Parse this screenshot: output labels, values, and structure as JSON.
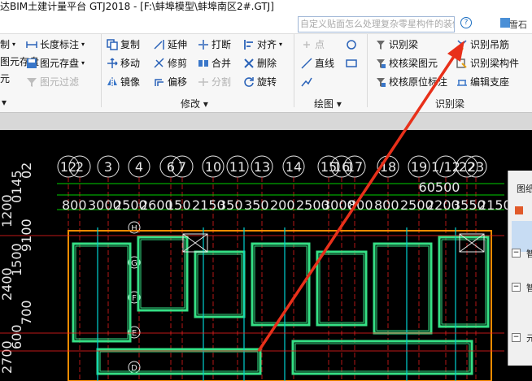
{
  "window": {
    "title": "达BIM土建计量平台 GTJ2018 - [F:\\蚌埠模型\\蚌埠南区2#.GTJ]"
  },
  "search": {
    "placeholder": "自定义贴面怎么处理复杂零星构件的装修?"
  },
  "user": {
    "name": "雪石"
  },
  "ribbon": {
    "col1": [
      "制",
      "图元存盘",
      "元"
    ],
    "col2": [
      "长度标注",
      "图元存盘",
      "图元过滤"
    ],
    "modify": {
      "copy": "复制",
      "extend": "延伸",
      "break": "打断",
      "align": "对齐",
      "move": "移动",
      "trim": "修剪",
      "merge": "合并",
      "delete": "删除",
      "mirror": "镜像",
      "offset": "偏移",
      "split": "分割",
      "rotate": "旋转",
      "group_label": "修改"
    },
    "draw": {
      "point": "点",
      "line": "直线",
      "group_label": "绘图"
    },
    "beam": {
      "identify_beam": "识别梁",
      "identify_hanger": "识别吊筋",
      "check_beam": "校核梁图元",
      "identify_beam_comp": "识别梁构件",
      "check_origin": "校核原位标注",
      "edit_support": "编辑支座",
      "group_label": "识别梁"
    },
    "col1_label": "制"
  },
  "cad": {
    "axis_top": [
      "12",
      "2",
      "3",
      "4",
      "6",
      "7",
      "10",
      "11",
      "13",
      "14",
      "15",
      "16",
      "17",
      "18",
      "19",
      "1/12",
      "22",
      "23"
    ],
    "axis_nums_row": [
      "800",
      "3000",
      "2500",
      "2600",
      "150",
      "2150",
      "350",
      "350",
      "200",
      "2500",
      "3000",
      "800",
      "800",
      "2500",
      "2200",
      "3550",
      "2150"
    ],
    "top_dim": "60500",
    "left_dims": [
      "2700",
      "600",
      "700",
      "2400",
      "1500",
      "9100",
      "1200",
      "0145",
      "02"
    ],
    "left_letters": [
      "H",
      "G",
      "F",
      "E",
      "D"
    ]
  },
  "panel": {
    "title": "图纸",
    "rows": [
      "一",
      "智",
      "智",
      "元"
    ]
  },
  "colors": {
    "arrow": "#e8301a",
    "grid_green": "#00d000",
    "wall_green": "#35e085",
    "cyan": "#00d0d0",
    "red_line": "#ff2020",
    "white": "#e8e8e8",
    "orange": "#ff8c00"
  }
}
